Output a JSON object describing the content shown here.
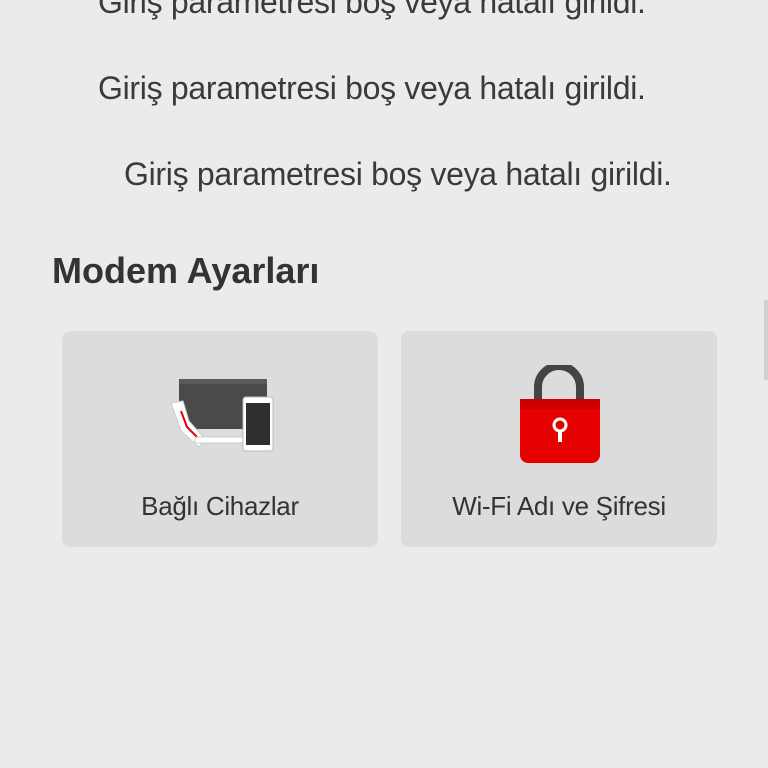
{
  "messages": {
    "errors": [
      "Giriş parametresi boş veya hatalı girildi.",
      "Giriş parametresi boş veya hatalı girildi.",
      "Giriş parametresi boş veya hatalı girildi."
    ]
  },
  "modem_settings": {
    "title": "Modem Ayarları",
    "cards": [
      {
        "label": "Bağlı Cihazlar",
        "icon": "connected-devices-icon"
      },
      {
        "label": "Wi-Fi Adı ve Şifresi",
        "icon": "padlock-icon"
      }
    ]
  },
  "colors": {
    "background": "#ebebeb",
    "card_background": "#dcdcdc",
    "accent_red": "#e60000",
    "text": "#333333"
  }
}
